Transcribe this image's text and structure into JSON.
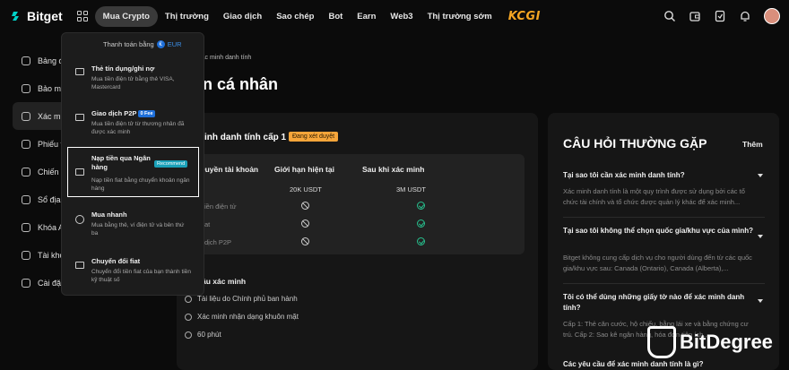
{
  "header": {
    "logo": "Bitget",
    "nav": [
      "Mua Crypto",
      "Thị trường",
      "Giao dịch",
      "Sao chép",
      "Bot",
      "Earn",
      "Web3",
      "Thị trường sớm"
    ],
    "partner": "KCGI",
    "icons": [
      "search-icon",
      "wallet-icon",
      "document-icon",
      "bell-icon",
      "avatar"
    ]
  },
  "sidebar": {
    "items": [
      "Bảng điều khiển",
      "Bảo mật",
      "Xác minh",
      "Phiếu thưởng",
      "Chiến dịch",
      "Sổ địa chỉ",
      "Khóa API",
      "Tài khoản",
      "Cài đặt"
    ]
  },
  "main": {
    "breadcrumb": "Xác minh danh tính",
    "title": "n cá nhân",
    "level_title": "inh danh tính cấp 1",
    "level_badge": "Đang xét duyệt",
    "table": {
      "headers": [
        "Quyền tài khoản",
        "Giới hạn hiện tại",
        "Sau khi xác minh"
      ],
      "limits": [
        "20K USDT",
        "3M USDT"
      ],
      "rows": [
        "iền điện tử",
        "at",
        "dịch P2P"
      ]
    },
    "requirements_title": "ầu xác minh",
    "requirements": [
      "Tài liệu do Chính phủ ban hành",
      "Xác minh nhận dạng khuôn mặt",
      "60 phút"
    ]
  },
  "faq": {
    "title": "CÂU HỎI THƯỜNG GẶP",
    "more": "Thêm",
    "items": [
      {
        "q": "Tại sao tôi cần xác minh danh tính?",
        "a": "Xác minh danh tính là một quy trình được sử dụng bởi các tổ chức tài chính và tổ chức được quản lý khác để xác minh..."
      },
      {
        "q": "Tại sao tôi không thể chọn quốc gia/khu vực của mình?",
        "a": "Bitget không cung cấp dịch vụ cho người dùng đến từ các quốc gia/khu vực sau: Canada (Ontario), Canada (Alberta),..."
      },
      {
        "q": "Tôi có thể dùng những giấy tờ nào để xác minh danh tính?",
        "a": "Cấp 1: Thẻ căn cước, hộ chiếu, bằng lái xe và bằng chứng cư trú. Cấp 2: Sao kê ngân hàng, hóa đơn tiện ích..."
      },
      {
        "q": "Các yêu cầu để xác minh danh tính là gì?",
        "a": ""
      }
    ]
  },
  "dropdown": {
    "pay_with": "Thanh toán bằng",
    "currency": "EUR",
    "items": [
      {
        "title": "Thẻ tín dụng/ghi nợ",
        "desc": "Mua tiền điện tử bằng thẻ VISA, Mastercard"
      },
      {
        "title": "Giao dịch P2P",
        "tag": "0 Fee",
        "desc": "Mua tiền điện tử từ thương nhân đã được xác minh"
      },
      {
        "title": "Nạp tiền qua Ngân hàng",
        "tag": "Recommend",
        "desc": "Nạp tiền fiat bằng chuyển khoản ngân hàng"
      },
      {
        "title": "Mua nhanh",
        "desc": "Mua bằng thẻ, ví điện tử và bên thứ ba"
      },
      {
        "title": "Chuyển đổi fiat",
        "desc": "Chuyển đổi tiền fiat của bạn thành tiền kỹ thuật số"
      }
    ]
  },
  "watermark": "BitDegree"
}
